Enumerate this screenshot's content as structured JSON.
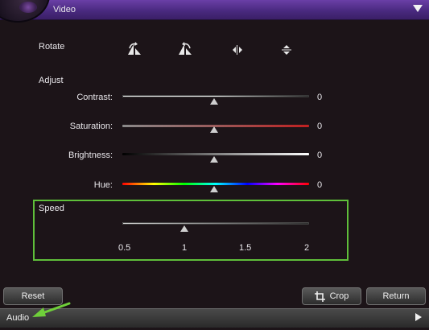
{
  "header": {
    "title": "Video"
  },
  "rotate": {
    "label": "Rotate",
    "buttons": [
      "rotate-left-icon",
      "rotate-right-icon",
      "flip-horizontal-icon",
      "flip-vertical-icon"
    ]
  },
  "adjust": {
    "label": "Adjust",
    "contrast": {
      "label": "Contrast:",
      "value": "0"
    },
    "saturation": {
      "label": "Saturation:",
      "value": "0"
    },
    "brightness": {
      "label": "Brightness:",
      "value": "0"
    },
    "hue": {
      "label": "Hue:",
      "value": "0"
    }
  },
  "speed": {
    "label": "Speed",
    "ticks": [
      "0.5",
      "1",
      "1.5",
      "2"
    ],
    "value": 1
  },
  "buttons": {
    "reset": "Reset",
    "crop": "Crop",
    "return": "Return"
  },
  "footer": {
    "title": "Audio"
  },
  "colors": {
    "header": "#5a3594",
    "highlight": "#5fbf3a",
    "background": "#1c1418"
  }
}
